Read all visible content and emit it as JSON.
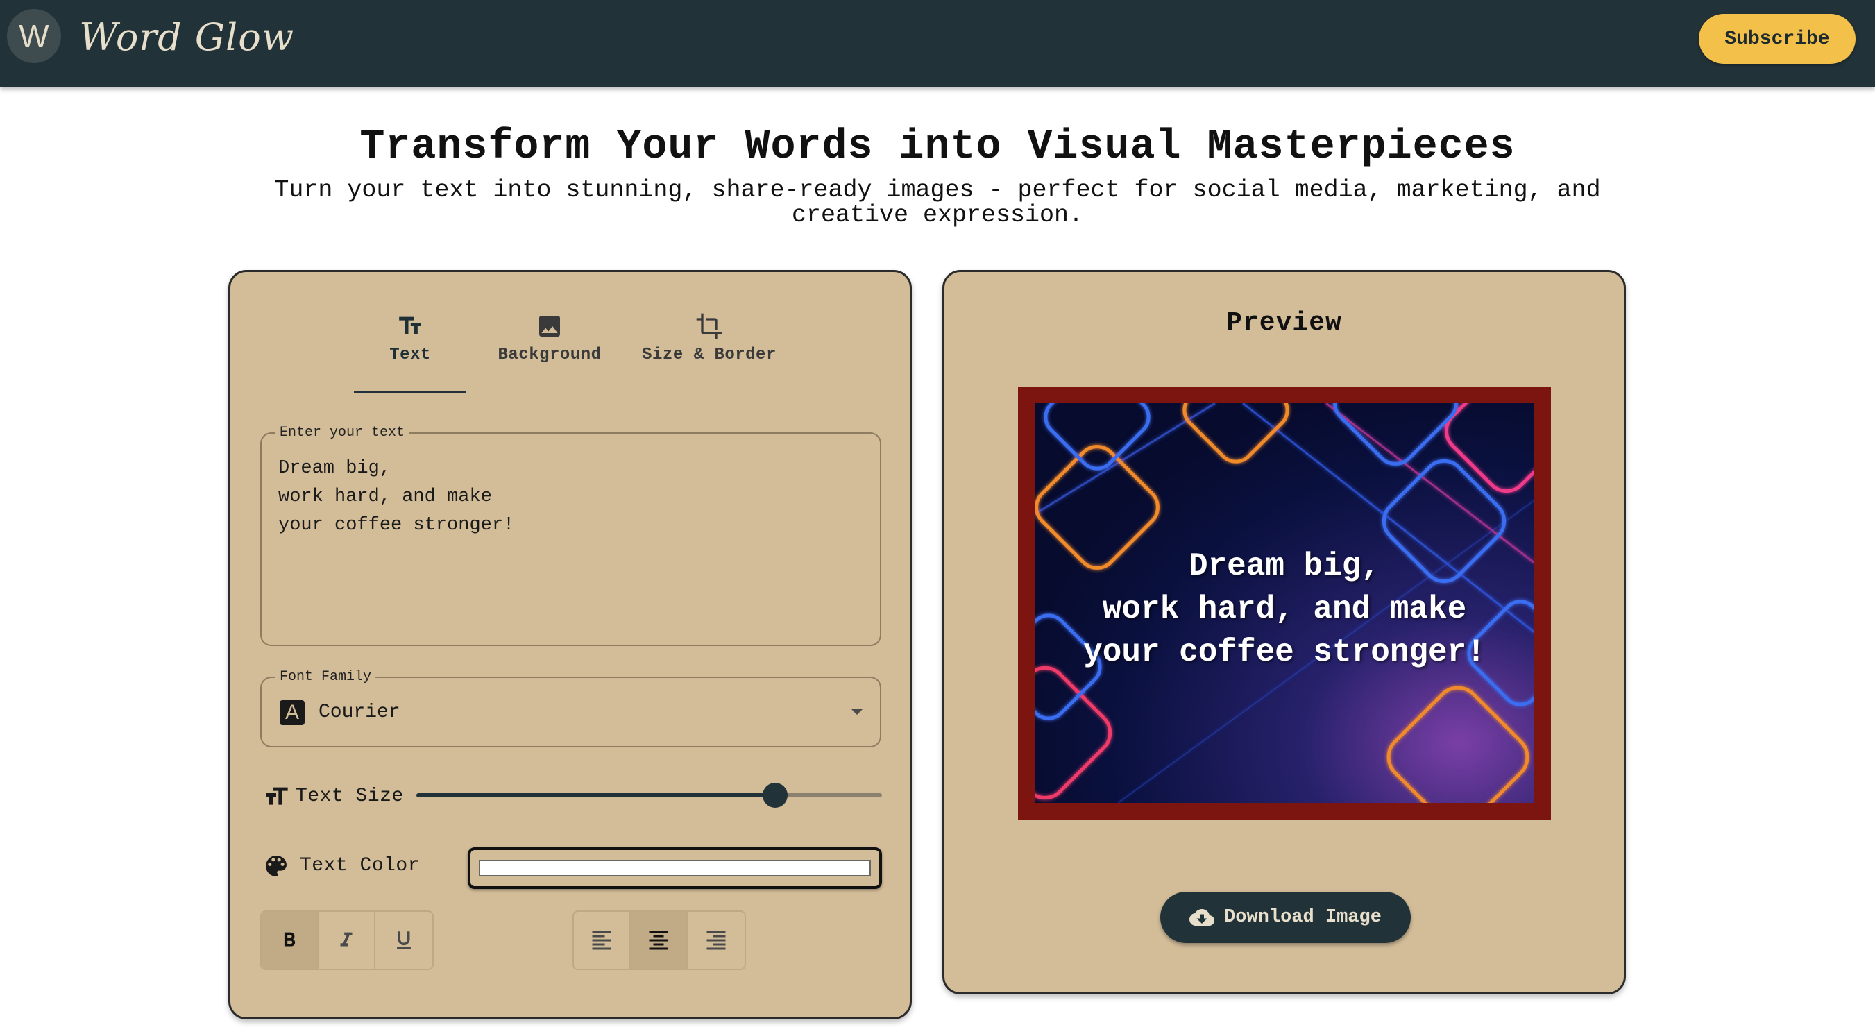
{
  "header": {
    "avatar_letter": "W",
    "brand": "Word Glow",
    "subscribe_label": "Subscribe"
  },
  "hero": {
    "title": "Transform Your Words into Visual Masterpieces",
    "subtitle": "Turn your text into stunning, share-ready images - perfect for social media, marketing, and creative expression."
  },
  "editor": {
    "tabs": [
      {
        "label": "Text",
        "icon": "text-fields-icon",
        "active": true
      },
      {
        "label": "Background",
        "icon": "image-icon",
        "active": false
      },
      {
        "label": "Size & Border",
        "icon": "crop-icon",
        "active": false
      }
    ],
    "text_field": {
      "label": "Enter your text",
      "value": "Dream big,\nwork hard, and make\nyour coffee stronger!"
    },
    "font_family": {
      "label": "Font Family",
      "value": "Courier"
    },
    "text_size": {
      "label": "Text Size",
      "value_fraction": 0.77
    },
    "text_color": {
      "label": "Text Color",
      "value": "#ffffff"
    },
    "style_buttons": [
      {
        "name": "bold",
        "label": "B",
        "active": true
      },
      {
        "name": "italic",
        "label": "I",
        "active": false
      },
      {
        "name": "underline",
        "label": "U",
        "active": false
      }
    ],
    "align_buttons": [
      {
        "name": "align-left",
        "active": false
      },
      {
        "name": "align-center",
        "active": true
      },
      {
        "name": "align-right",
        "active": false
      }
    ]
  },
  "preview": {
    "title": "Preview",
    "quote": "Dream big,\nwork hard, and make\nyour coffee stronger!",
    "border_color": "#7c150f",
    "download_label": "Download Image"
  },
  "colors": {
    "header_bg": "#213238",
    "panel_bg": "#d3bd99",
    "accent": "#f3c04a"
  }
}
